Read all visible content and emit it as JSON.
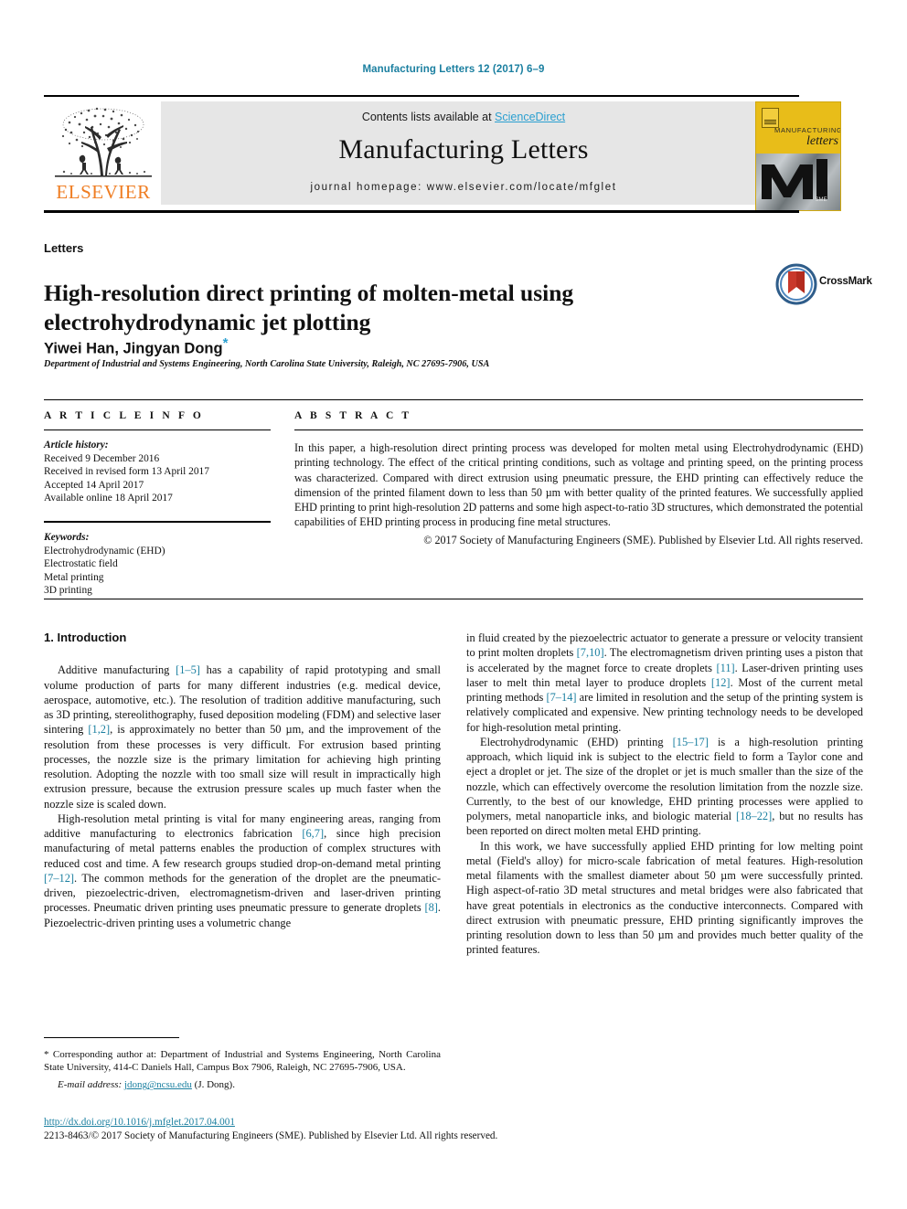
{
  "running_head": "Manufacturing Letters 12 (2017) 6–9",
  "masthead": {
    "publisher_name": "ELSEVIER",
    "contents_prefix": "Contents lists available at ",
    "contents_link": "ScienceDirect",
    "journal_name": "Manufacturing Letters",
    "journal_homepage": "journal homepage: www.elsevier.com/locate/mfglet",
    "cover": {
      "line1": "MANUFACTURING",
      "line2": "letters",
      "society_mark": "SME"
    }
  },
  "article": {
    "section_label": "Letters",
    "title": "High-resolution direct printing of molten-metal using electrohydrodynamic jet plotting",
    "authors": "Yiwei Han, Jingyan Dong",
    "corresponding_mark": "*",
    "affiliation": "Department of Industrial and Systems Engineering, North Carolina State University, Raleigh, NC 27695-7906, USA",
    "crossmark_label": "CrossMark"
  },
  "article_info": {
    "heading": "A R T I C L E  I N F O",
    "history_label": "Article history:",
    "history": [
      "Received 9 December 2016",
      "Received in revised form 13 April 2017",
      "Accepted 14 April 2017",
      "Available online 18 April 2017"
    ],
    "keywords_label": "Keywords:",
    "keywords": [
      "Electrohydrodynamic (EHD)",
      "Electrostatic field",
      "Metal printing",
      "3D printing"
    ]
  },
  "abstract": {
    "heading": "A B S T R A C T",
    "text": "In this paper, a high-resolution direct printing process was developed for molten metal using Electrohydrodynamic (EHD) printing technology. The effect of the critical printing conditions, such as voltage and printing speed, on the printing process was characterized. Compared with direct extrusion using pneumatic pressure, the EHD printing can effectively reduce the dimension of the printed filament down to less than 50 µm with better quality of the printed features. We successfully applied EHD printing to print high-resolution 2D patterns and some high aspect-to-ratio 3D structures, which demonstrated the potential capabilities of EHD printing process in producing fine metal structures.",
    "copyright": "© 2017 Society of Manufacturing Engineers (SME). Published by Elsevier Ltd. All rights reserved."
  },
  "body": {
    "intro_heading": "1. Introduction",
    "left_paragraphs": [
      "Additive manufacturing [1–5] has a capability of rapid prototyping and small volume production of parts for many different industries (e.g. medical device, aerospace, automotive, etc.). The resolution of tradition additive manufacturing, such as 3D printing, stereolithography, fused deposition modeling (FDM) and selective laser sintering [1,2], is approximately no better than 50 µm, and the improvement of the resolution from these processes is very difficult. For extrusion based printing processes, the nozzle size is the primary limitation for achieving high printing resolution. Adopting the nozzle with too small size will result in impractically high extrusion pressure, because the extrusion pressure scales up much faster when the nozzle size is scaled down.",
      "High-resolution metal printing is vital for many engineering areas, ranging from additive manufacturing to electronics fabrication [6,7], since high precision manufacturing of metal patterns enables the production of complex structures with reduced cost and time. A few research groups studied drop-on-demand metal printing [7–12]. The common methods for the generation of the droplet are the pneumatic-driven, piezoelectric-driven, electromagnetism-driven and laser-driven printing processes. Pneumatic driven printing uses pneumatic pressure to generate droplets [8]. Piezoelectric-driven printing uses a volumetric change"
    ],
    "right_paragraphs": [
      "in fluid created by the piezoelectric actuator to generate a pressure or velocity transient to print molten droplets [7,10]. The electromagnetism driven printing uses a piston that is accelerated by the magnet force to create droplets [11]. Laser-driven printing uses laser to melt thin metal layer to produce droplets [12]. Most of the current metal printing methods [7–14] are limited in resolution and the setup of the printing system is relatively complicated and expensive. New printing technology needs to be developed for high-resolution metal printing.",
      "Electrohydrodynamic (EHD) printing [15–17] is a high-resolution printing approach, which liquid ink is subject to the electric field to form a Taylor cone and eject a droplet or jet. The size of the droplet or jet is much smaller than the size of the nozzle, which can effectively overcome the resolution limitation from the nozzle size. Currently, to the best of our knowledge, EHD printing processes were applied to polymers, metal nanoparticle inks, and biologic material [18–22], but no results has been reported on direct molten metal EHD printing.",
      "In this work, we have successfully applied EHD printing for low melting point metal (Field's alloy) for micro-scale fabrication of metal features. High-resolution metal filaments with the smallest diameter about 50 µm were successfully printed. High aspect-of-ratio 3D metal structures and metal bridges were also fabricated that have great potentials in electronics as the conductive interconnects. Compared with direct extrusion with pneumatic pressure, EHD printing significantly improves the printing resolution down to less than 50 µm and provides much better quality of the printed features."
    ]
  },
  "footnote": {
    "corresponding_symbol": "*",
    "corresponding_text": " Corresponding author at: Department of Industrial and Systems Engineering, North Carolina State University, 414-C Daniels Hall, Campus Box 7906, Raleigh, NC 27695-7906, USA.",
    "email_label": "E-mail address:",
    "email": "jdong@ncsu.edu",
    "email_suffix": " (J. Dong)."
  },
  "footer": {
    "doi": "http://dx.doi.org/10.1016/j.mfglet.2017.04.001",
    "issn_copyright": "2213-8463/© 2017 Society of Manufacturing Engineers (SME). Published by Elsevier Ltd. All rights reserved."
  },
  "colors": {
    "link": "#1a7fa0",
    "sciencedirect": "#2a9fd0",
    "elsevier_orange": "#ef7d22",
    "cover_yellow": "#e8bd19",
    "band_grey": "#e6e6e6"
  }
}
